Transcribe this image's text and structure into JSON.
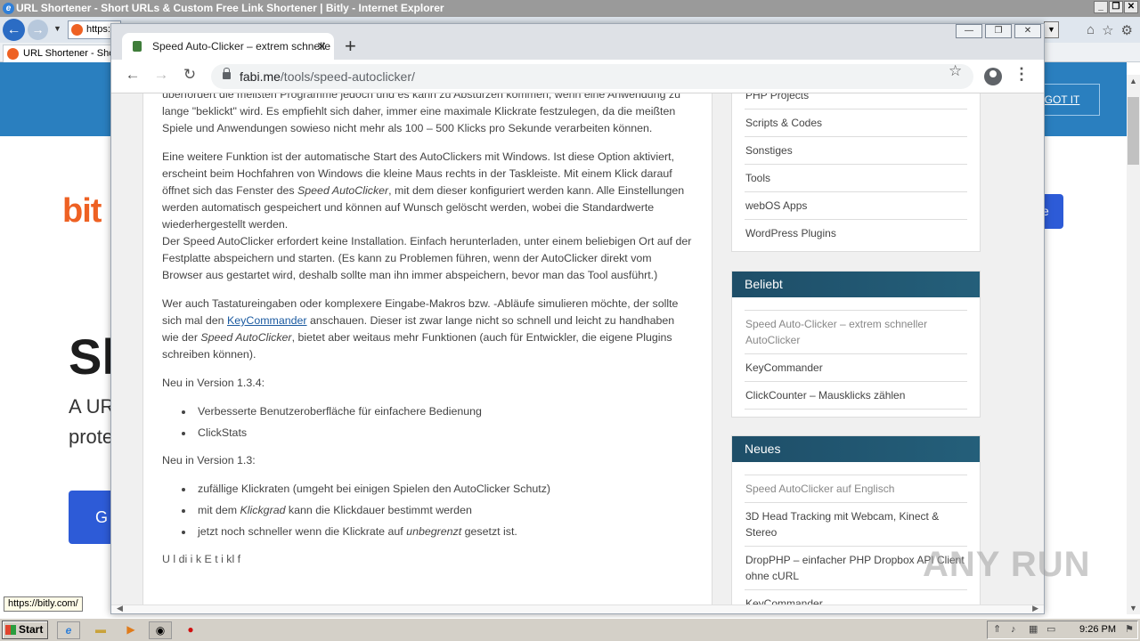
{
  "ie": {
    "title": "URL Shortener - Short URLs & Custom Free Link Shortener | Bitly - Internet Explorer",
    "logo_letter": "e",
    "address": "https:",
    "tab_label": "URL Shortener - Shor",
    "status_url": "https://bitly.com/",
    "icons": [
      "back-arrow-icon",
      "forward-arrow-icon",
      "home-icon",
      "star-icon",
      "gear-icon"
    ]
  },
  "bitly": {
    "got_it": "GOT IT",
    "logo": "bit",
    "headline": "Sl",
    "sub1": "A UR",
    "sub2": "prote",
    "cta": "G",
    "cta2": "e"
  },
  "chrome": {
    "tab_title": "Speed Auto-Clicker – extrem schnelle",
    "url_host": "fabi.me",
    "url_path": "/tools/speed-autoclicker/"
  },
  "article": {
    "p1": "überfordert die meißten Programme jedoch und es kann zu Abstürzen kommen, wenn eine Anwendung zu lange \"beklickt\" wird. Es empfiehlt sich daher, immer eine maximale Klickrate festzulegen, da die meißten Spiele und Anwendungen sowieso nicht mehr als 100 – 500 Klicks pro Sekunde verarbeiten können.",
    "p2a": "Eine weitere Funktion ist der automatische Start des AutoClickers mit Windows. Ist diese Option aktiviert, erscheint beim Hochfahren von Windows die kleine Maus rechts in der Taskleiste. Mit einem Klick darauf öffnet sich das Fenster des ",
    "p2_em": "Speed AutoClicker",
    "p2b": ",  mit dem dieser konfiguriert werden kann. Alle Einstellungen werden automatisch gespeichert und können auf Wunsch gelöscht werden, wobei die Standardwerte wiederhergestellt werden.",
    "p2c": "Der Speed AutoClicker erfordert keine Installation. Einfach herunterladen, unter einem beliebigen Ort auf der Festplatte abspeichern und starten. (Es kann zu Problemen führen, wenn der AutoClicker direkt vom Browser aus gestartet wird, deshalb sollte man ihn immer abspeichern, bevor man das Tool ausführt.)",
    "p3a": "Wer auch Tastatureingaben oder komplexere Eingabe-Makros bzw. -Abläufe simulieren möchte, der sollte sich mal den ",
    "p3_link": "KeyCommander",
    "p3b": " anschauen. Dieser ist zwar lange nicht so schnell und leicht zu handhaben wie der ",
    "p3_em": "Speed AutoClicker",
    "p3c": ", bietet aber weitaus mehr Funktionen (auch für Entwickler, die eigene Plugins schreiben können).",
    "v134_heading": "Neu in Version 1.3.4:",
    "v134_items": [
      "Verbesserte Benutzeroberfläche für einfachere Bedienung",
      "ClickStats"
    ],
    "v13_heading": "Neu in Version 1.3:",
    "v13_i1": "zufällige Klickraten (umgeht bei einigen Spielen den AutoClicker Schutz)",
    "v13_i2a": "mit dem ",
    "v13_i2_em": "Klickgrad",
    "v13_i2b": " kann die Klickdauer bestimmt werden",
    "v13_i3a": "jetzt noch schneller wenn die Klickrate auf ",
    "v13_i3_em": "unbegrenzt",
    "v13_i3b": " gesetzt ist.",
    "cut_line": "U  l                 di   i  k    E  t i  kl   f   "
  },
  "sidebar": {
    "categories": [
      "PHP Projects",
      "Scripts & Codes",
      "Sonstiges",
      "Tools",
      "webOS Apps",
      "WordPress Plugins"
    ],
    "beliebt_title": "Beliebt",
    "beliebt": [
      "Speed Auto-Clicker – extrem schneller AutoClicker",
      "KeyCommander",
      "ClickCounter – Mausklicks zählen"
    ],
    "neues_title": "Neues",
    "neues": [
      "Speed AutoClicker auf Englisch",
      "3D Head Tracking mit Webcam, Kinect & Stereo",
      "DropPHP – einfacher PHP Dropbox API Client ohne cURL",
      "KeyCommander"
    ]
  },
  "watermark": "ANY RUN",
  "taskbar": {
    "start": "Start",
    "clock": "9:26 PM"
  }
}
